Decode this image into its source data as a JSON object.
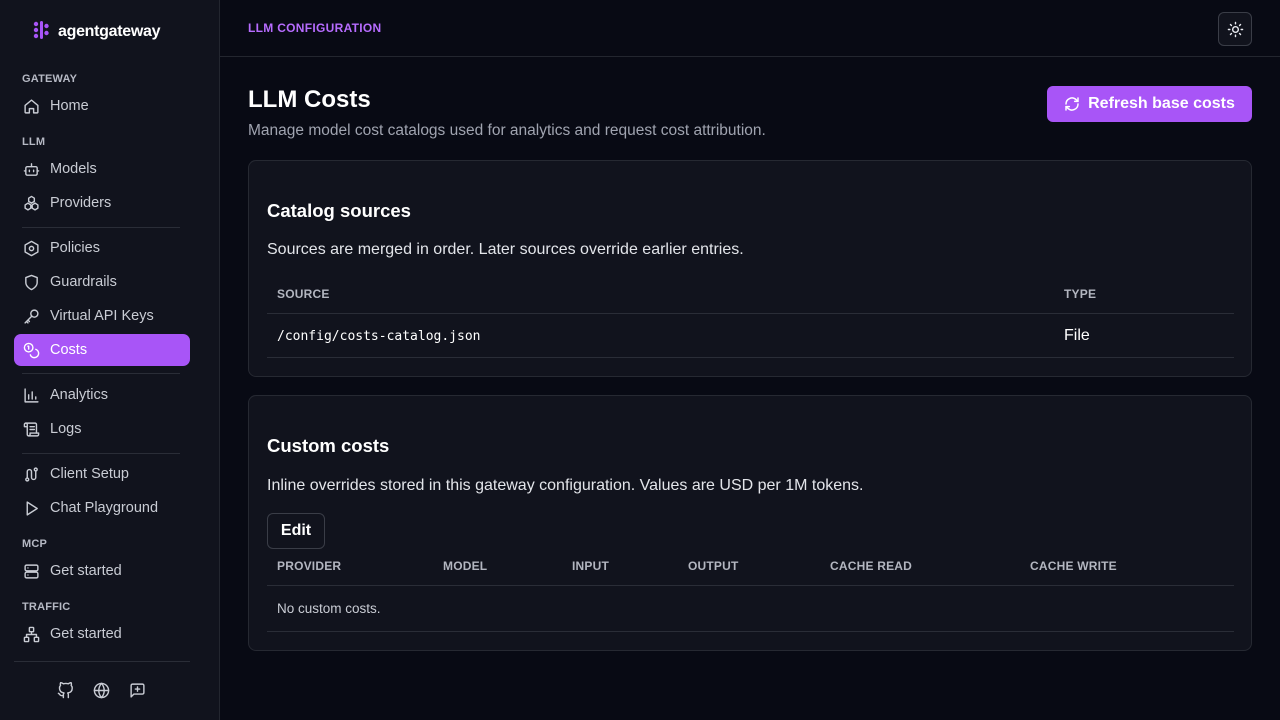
{
  "brand": {
    "name": "agentgateway",
    "logo_icon": "agentgateway-logo-icon",
    "accent": "#a855f7"
  },
  "sidebar": {
    "sections": {
      "gateway": "GATEWAY",
      "llm": "LLM",
      "mcp": "MCP",
      "traffic": "TRAFFIC"
    },
    "items": {
      "home": {
        "label": "Home",
        "icon": "home-icon"
      },
      "models": {
        "label": "Models",
        "icon": "robot-icon"
      },
      "providers": {
        "label": "Providers",
        "icon": "boxes-icon"
      },
      "policies": {
        "label": "Policies",
        "icon": "hexagon-gear-icon"
      },
      "guardrails": {
        "label": "Guardrails",
        "icon": "shield-icon"
      },
      "virtual_keys": {
        "label": "Virtual API Keys",
        "icon": "key-icon"
      },
      "costs": {
        "label": "Costs",
        "icon": "coins-icon",
        "active": true
      },
      "analytics": {
        "label": "Analytics",
        "icon": "bar-chart-icon"
      },
      "logs": {
        "label": "Logs",
        "icon": "scroll-icon"
      },
      "client_setup": {
        "label": "Client Setup",
        "icon": "route-icon"
      },
      "chat_playground": {
        "label": "Chat Playground",
        "icon": "play-icon"
      },
      "mcp_get_started": {
        "label": "Get started",
        "icon": "server-icon"
      },
      "traffic_get_started": {
        "label": "Get started",
        "icon": "network-icon"
      }
    },
    "footer_icons": [
      "github-icon",
      "globe-icon",
      "feedback-icon"
    ]
  },
  "topbar": {
    "title": "LLM CONFIGURATION",
    "theme_icon": "sun-icon"
  },
  "page": {
    "title": "LLM Costs",
    "subtitle": "Manage model cost catalogs used for analytics and request cost attribution.",
    "refresh_label": "Refresh base costs"
  },
  "catalog": {
    "title": "Catalog sources",
    "description": "Sources are merged in order. Later sources override earlier entries.",
    "columns": {
      "source": "SOURCE",
      "type": "TYPE"
    },
    "rows": [
      {
        "source": "/config/costs-catalog.json",
        "type": "File"
      }
    ]
  },
  "custom": {
    "title": "Custom costs",
    "description": "Inline overrides stored in this gateway configuration. Values are USD per 1M tokens.",
    "edit_label": "Edit",
    "columns": {
      "provider": "PROVIDER",
      "model": "MODEL",
      "input": "INPUT",
      "output": "OUTPUT",
      "cache_read": "CACHE READ",
      "cache_write": "CACHE WRITE"
    },
    "empty_text": "No custom costs."
  }
}
